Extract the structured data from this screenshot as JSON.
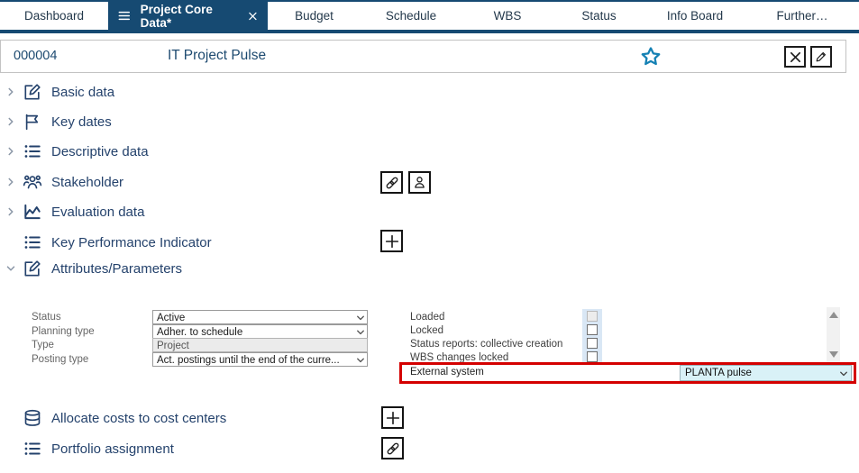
{
  "colors": {
    "navy": "#164a72",
    "section_blue": "#24426c",
    "star_teal": "#1581b4",
    "highlight_red": "#d40000",
    "external_field_cyan": "#d9f1f7",
    "checkbox_column_blue": "#d9e7f5"
  },
  "tabbar": {
    "tabs": [
      {
        "label": "Dashboard"
      },
      {
        "label": "Project Core Data*"
      },
      {
        "label": "Budget"
      },
      {
        "label": "Schedule"
      },
      {
        "label": "WBS"
      },
      {
        "label": "Status"
      },
      {
        "label": "Info Board"
      },
      {
        "label": "Further…"
      }
    ]
  },
  "header": {
    "project_id": "000004",
    "project_title": "IT Project Pulse"
  },
  "sections": {
    "basic_data": "Basic data",
    "key_dates": "Key dates",
    "descriptive_data": "Descriptive data",
    "stakeholder": "Stakeholder",
    "evaluation_data": "Evaluation data",
    "kpi": "Key Performance Indicator",
    "attributes": "Attributes/Parameters",
    "allocate_costs": "Allocate costs to cost centers",
    "portfolio": "Portfolio assignment"
  },
  "form": {
    "status": {
      "label": "Status",
      "value": "Active"
    },
    "planning_type": {
      "label": "Planning type",
      "value": "Adher. to schedule"
    },
    "type": {
      "label": "Type",
      "value": "Project"
    },
    "posting_type": {
      "label": "Posting type",
      "value": "Act. postings until the end of the curre..."
    },
    "loaded": {
      "label": "Loaded",
      "checked": false,
      "disabled": true
    },
    "locked": {
      "label": "Locked",
      "checked": false
    },
    "status_reports": {
      "label": "Status reports: collective creation",
      "checked": false
    },
    "wbs_changes_locked": {
      "label": "WBS changes locked",
      "checked": false
    },
    "external_system": {
      "label": "External system",
      "value": "PLANTA pulse"
    }
  }
}
